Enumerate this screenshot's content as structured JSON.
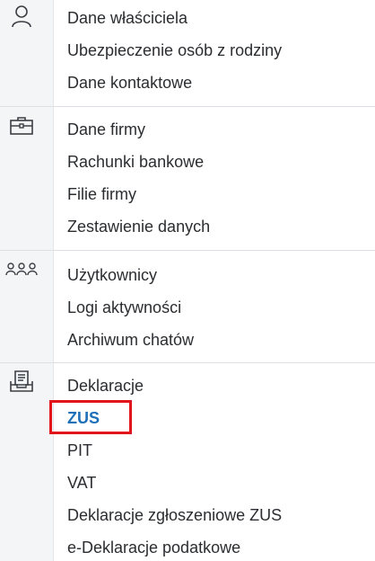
{
  "sections": [
    {
      "icon": "user-icon",
      "items": [
        "Dane właściciela",
        "Ubezpieczenie osób z rodziny",
        "Dane kontaktowe"
      ]
    },
    {
      "icon": "briefcase-icon",
      "items": [
        "Dane firmy",
        "Rachunki bankowe",
        "Filie firmy",
        "Zestawienie danych"
      ]
    },
    {
      "icon": "users-group-icon",
      "items": [
        "Użytkownicy",
        "Logi aktywności",
        "Archiwum chatów"
      ]
    },
    {
      "icon": "document-tray-icon",
      "items": [
        "Deklaracje",
        "ZUS",
        "PIT",
        "VAT",
        "Deklaracje zgłoszeniowe ZUS",
        "e-Deklaracje podatkowe"
      ]
    }
  ],
  "active_item": "ZUS",
  "colors": {
    "active_text": "#1c6fb8",
    "highlight_border": "#e2141c",
    "rail_background": "#f4f5f6"
  }
}
